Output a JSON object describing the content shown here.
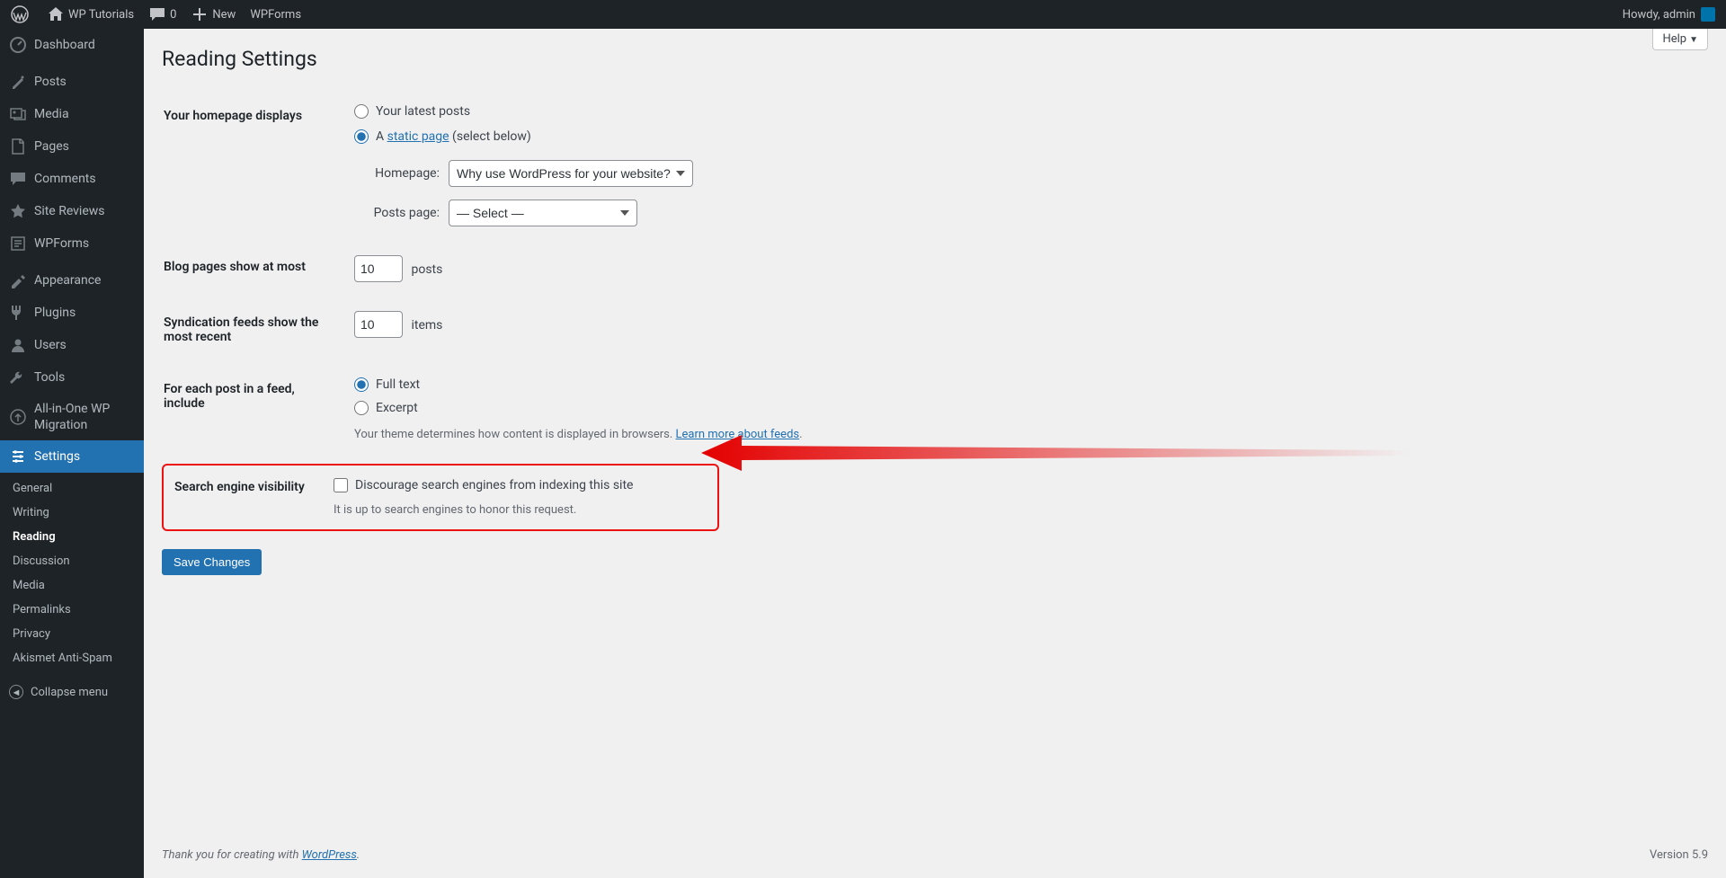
{
  "adminbar": {
    "site_title": "WP Tutorials",
    "comments_count": "0",
    "new_label": "New",
    "wpforms_label": "WPForms",
    "howdy_prefix": "Howdy, ",
    "username": "admin"
  },
  "sidebar": {
    "items": [
      {
        "label": "Dashboard",
        "icon": "dashboard"
      },
      {
        "label": "Posts",
        "icon": "post"
      },
      {
        "label": "Media",
        "icon": "media"
      },
      {
        "label": "Pages",
        "icon": "page"
      },
      {
        "label": "Comments",
        "icon": "comment"
      },
      {
        "label": "Site Reviews",
        "icon": "star"
      },
      {
        "label": "WPForms",
        "icon": "wpforms"
      },
      {
        "label": "Appearance",
        "icon": "appearance"
      },
      {
        "label": "Plugins",
        "icon": "plugin"
      },
      {
        "label": "Users",
        "icon": "user"
      },
      {
        "label": "Tools",
        "icon": "tool"
      },
      {
        "label": "All-in-One WP Migration",
        "icon": "migrate"
      },
      {
        "label": "Settings",
        "icon": "settings"
      }
    ],
    "submenu": [
      "General",
      "Writing",
      "Reading",
      "Discussion",
      "Media",
      "Permalinks",
      "Privacy",
      "Akismet Anti-Spam"
    ],
    "collapse_label": "Collapse menu"
  },
  "help_label": "Help",
  "page_title": "Reading Settings",
  "form": {
    "homepage_th": "Your homepage displays",
    "radio_latest": "Your latest posts",
    "radio_static_prefix": "A ",
    "radio_static_link": "static page",
    "radio_static_suffix": " (select below)",
    "homepage_label": "Homepage:",
    "homepage_value": "Why use WordPress for your website?",
    "posts_page_label": "Posts page:",
    "posts_page_value": "— Select —",
    "blog_pages_th": "Blog pages show at most",
    "blog_pages_value": "10",
    "blog_pages_unit": "posts",
    "syndication_th": "Syndication feeds show the most recent",
    "syndication_value": "10",
    "syndication_unit": "items",
    "feed_content_th": "For each post in a feed, include",
    "feed_full": "Full text",
    "feed_excerpt": "Excerpt",
    "feed_note_prefix": "Your theme determines how content is displayed in browsers. ",
    "feed_note_link": "Learn more about feeds",
    "sev_th": "Search engine visibility",
    "sev_checkbox_label": "Discourage search engines from indexing this site",
    "sev_note": "It is up to search engines to honor this request.",
    "save_label": "Save Changes"
  },
  "footer": {
    "thanks_prefix": "Thank you for creating with ",
    "thanks_link": "WordPress",
    "version": "Version 5.9"
  }
}
